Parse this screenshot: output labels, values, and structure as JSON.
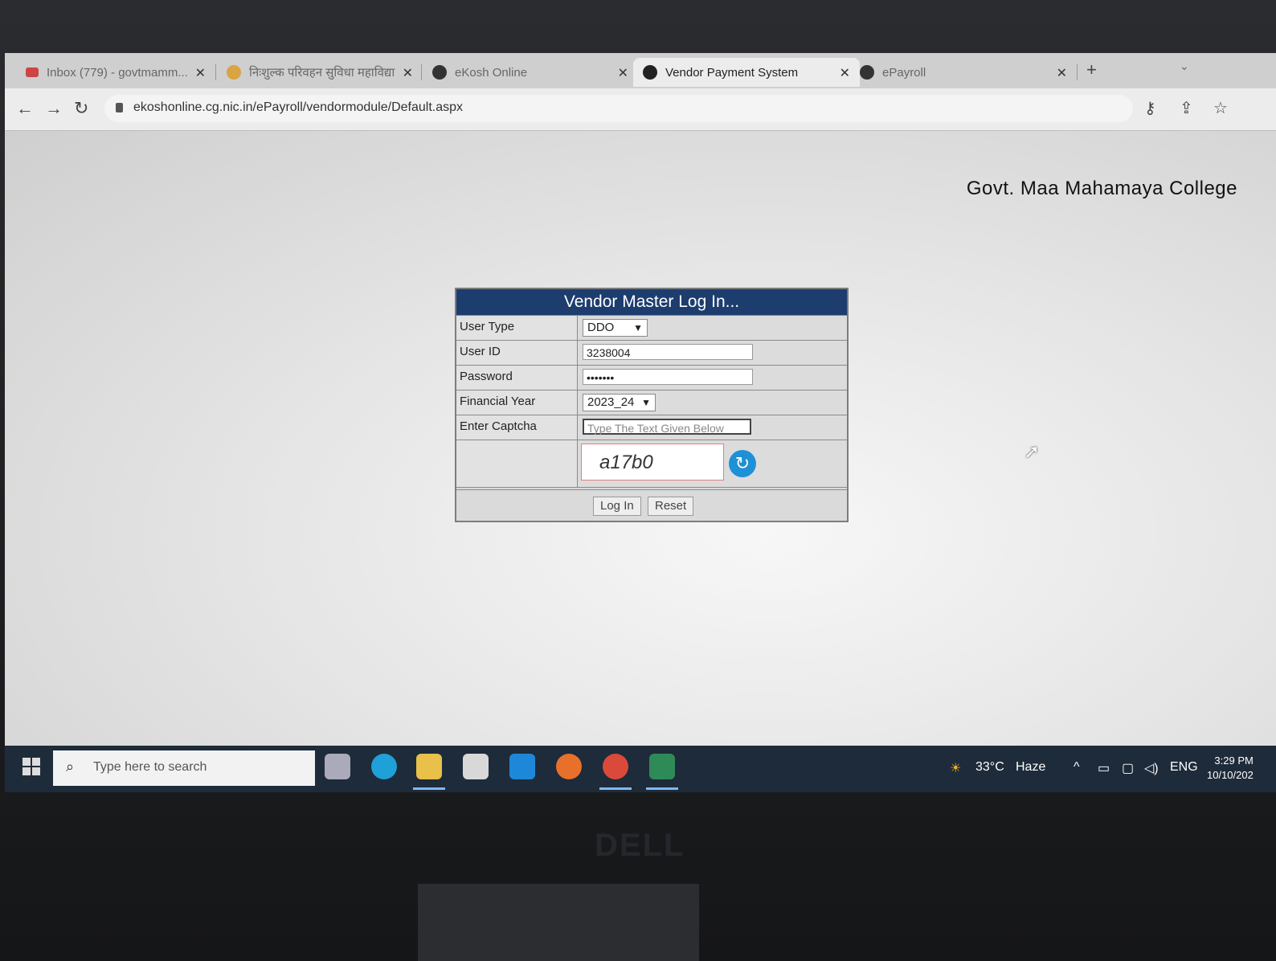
{
  "tabs": [
    {
      "label": "Inbox (779) - govtmamm...",
      "active": false
    },
    {
      "label": "निःशुल्क परिवहन सुविधा महाविद्या",
      "active": false
    },
    {
      "label": "eKosh Online",
      "active": false
    },
    {
      "label": "Vendor Payment System",
      "active": true
    },
    {
      "label": "ePayroll",
      "active": false
    }
  ],
  "toolbar": {
    "url": "ekoshonline.cg.nic.in/ePayroll/vendormodule/Default.aspx"
  },
  "page": {
    "college": "Govt. Maa Mahamaya College"
  },
  "login": {
    "title": "Vendor Master Log In...",
    "user_type_label": "User Type",
    "user_type_value": "DDO",
    "user_id_label": "User ID",
    "user_id_value": "3238004",
    "password_label": "Password",
    "password_value": "•••••••",
    "fy_label": "Financial Year",
    "fy_value": "2023_24",
    "captcha_label": "Enter Captcha",
    "captcha_placeholder": "Type The Text Given Below",
    "captcha_text": "a17b0",
    "login_btn": "Log In",
    "reset_btn": "Reset"
  },
  "taskbar": {
    "search_placeholder": "Type here to search",
    "weather": "33°C",
    "weather_desc": "Haze",
    "lang": "ENG",
    "time": "3:29 PM",
    "date": "10/10/202"
  },
  "monitor": {
    "brand": "DELL"
  }
}
